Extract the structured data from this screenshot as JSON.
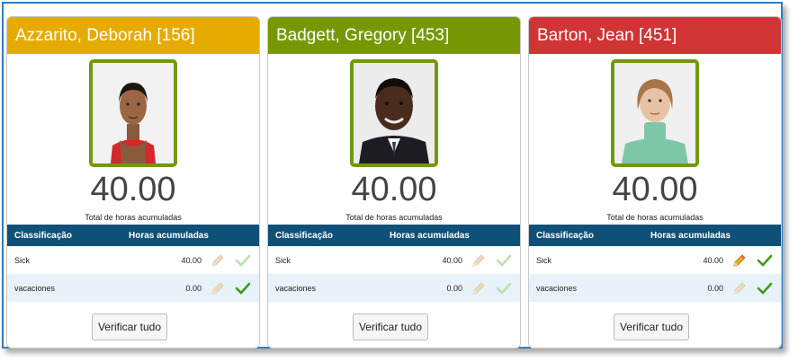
{
  "colors": {
    "header_yellow": "#e5ab00",
    "header_green": "#779704",
    "header_red": "#d03434",
    "table_header": "#0f5079",
    "photo_border": "#72980e",
    "check_active": "#4a9a1c",
    "check_inactive": "#b9deb0",
    "pencil_active": "#e0a020",
    "pencil_inactive": "#e8d9b8"
  },
  "columns": {
    "classification": "Classificação",
    "hours": "Horas acumuladas"
  },
  "caption": "Total de horas acumuladas",
  "verify_button": "Verificar tudo",
  "cards": [
    {
      "name": "Azzarito, Deborah [156]",
      "total": "40.00",
      "rows": [
        {
          "classification": "Sick",
          "hours": "40.00",
          "edit_icon": "pencil-icon",
          "edit_active": false,
          "check_icon": "checkmark-icon",
          "check_active": false
        },
        {
          "classification": "vacaciones",
          "hours": "0.00",
          "edit_icon": "pencil-icon",
          "edit_active": false,
          "check_icon": "checkmark-icon",
          "check_active": true
        }
      ]
    },
    {
      "name": "Badgett, Gregory [453]",
      "total": "40.00",
      "rows": [
        {
          "classification": "Sick",
          "hours": "40.00",
          "edit_icon": "pencil-icon",
          "edit_active": false,
          "check_icon": "checkmark-icon",
          "check_active": false
        },
        {
          "classification": "vacaciones",
          "hours": "0.00",
          "edit_icon": "pencil-icon",
          "edit_active": false,
          "check_icon": "checkmark-icon",
          "check_active": false
        }
      ]
    },
    {
      "name": "Barton, Jean [451]",
      "total": "40.00",
      "rows": [
        {
          "classification": "Sick",
          "hours": "40.00",
          "edit_icon": "pencil-icon",
          "edit_active": true,
          "check_icon": "checkmark-icon",
          "check_active": true
        },
        {
          "classification": "vacaciones",
          "hours": "0.00",
          "edit_icon": "pencil-icon",
          "edit_active": false,
          "check_icon": "checkmark-icon",
          "check_active": true
        }
      ]
    }
  ]
}
